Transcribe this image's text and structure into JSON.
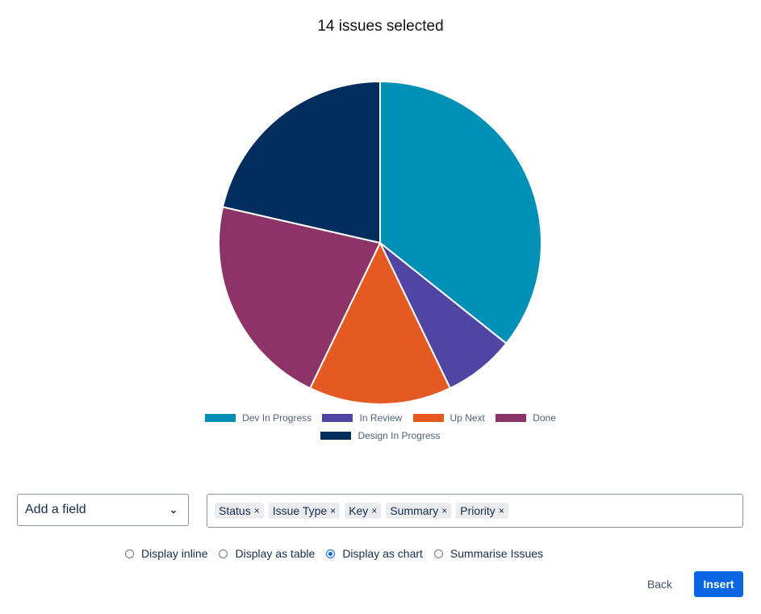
{
  "header": {
    "title": "14 issues selected"
  },
  "chart_data": {
    "type": "pie",
    "title": "14 issues selected",
    "categories": [
      "Dev In Progress",
      "In Review",
      "Up Next",
      "Done",
      "Design In Progress"
    ],
    "values": [
      5,
      1,
      2,
      3,
      3
    ],
    "colors": [
      "#0090B5",
      "#5145A3",
      "#E55A22",
      "#8C3367",
      "#022D5C"
    ],
    "legend": "bottom",
    "start_angle": "12 o'clock, clockwise"
  },
  "controls": {
    "field_select": {
      "label": "Add a field",
      "icon": "chevron-down-icon"
    },
    "tags": [
      {
        "label": "Status",
        "remove": "×"
      },
      {
        "label": "Issue Type",
        "remove": "×"
      },
      {
        "label": "Key",
        "remove": "×"
      },
      {
        "label": "Summary",
        "remove": "×"
      },
      {
        "label": "Priority",
        "remove": "×"
      }
    ],
    "display_options": [
      {
        "label": "Display inline",
        "checked": false
      },
      {
        "label": "Display as table",
        "checked": false
      },
      {
        "label": "Display as chart",
        "checked": true
      },
      {
        "label": "Summarise Issues",
        "checked": false
      }
    ]
  },
  "footer": {
    "back_label": "Back",
    "insert_label": "Insert"
  }
}
